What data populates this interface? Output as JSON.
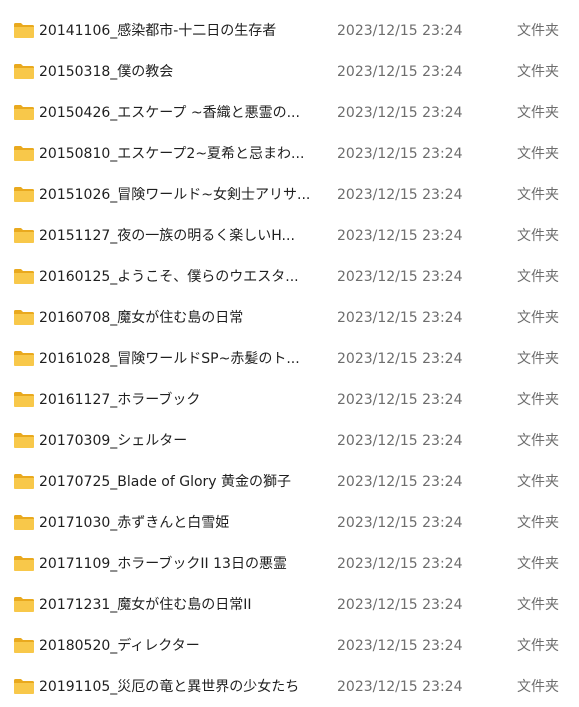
{
  "colors": {
    "folder_body": "#f8c84a",
    "folder_tab": "#e9a91e",
    "name_text": "#1f1f1f",
    "meta_text": "#6d6d6d",
    "background": "#ffffff"
  },
  "files": [
    {
      "name": "20141106_感染都市-十二日の生存者",
      "modified": "2023/12/15 23:24",
      "type": "文件夹",
      "icon": "folder-icon"
    },
    {
      "name": "20150318_僕の教会",
      "modified": "2023/12/15 23:24",
      "type": "文件夹",
      "icon": "folder-icon"
    },
    {
      "name": "20150426_エスケープ ~香織と悪霊の...",
      "modified": "2023/12/15 23:24",
      "type": "文件夹",
      "icon": "folder-icon"
    },
    {
      "name": "20150810_エスケープ2~夏希と忌まわ...",
      "modified": "2023/12/15 23:24",
      "type": "文件夹",
      "icon": "folder-icon"
    },
    {
      "name": "20151026_冒険ワールド~女剣士アリサ...",
      "modified": "2023/12/15 23:24",
      "type": "文件夹",
      "icon": "folder-icon"
    },
    {
      "name": "20151127_夜の一族の明るく楽しいH...",
      "modified": "2023/12/15 23:24",
      "type": "文件夹",
      "icon": "folder-icon"
    },
    {
      "name": "20160125_ようこそ、僕らのウエスタ...",
      "modified": "2023/12/15 23:24",
      "type": "文件夹",
      "icon": "folder-icon"
    },
    {
      "name": "20160708_魔女が住む島の日常",
      "modified": "2023/12/15 23:24",
      "type": "文件夹",
      "icon": "folder-icon"
    },
    {
      "name": "20161028_冒険ワールドSP~赤髪のト...",
      "modified": "2023/12/15 23:24",
      "type": "文件夹",
      "icon": "folder-icon"
    },
    {
      "name": "20161127_ホラーブック",
      "modified": "2023/12/15 23:24",
      "type": "文件夹",
      "icon": "folder-icon"
    },
    {
      "name": "20170309_シェルター",
      "modified": "2023/12/15 23:24",
      "type": "文件夹",
      "icon": "folder-icon"
    },
    {
      "name": "20170725_Blade of Glory 黄金の獅子",
      "modified": "2023/12/15 23:24",
      "type": "文件夹",
      "icon": "folder-icon"
    },
    {
      "name": "20171030_赤ずきんと白雪姫",
      "modified": "2023/12/15 23:24",
      "type": "文件夹",
      "icon": "folder-icon"
    },
    {
      "name": "20171109_ホラーブックII 13日の悪霊",
      "modified": "2023/12/15 23:24",
      "type": "文件夹",
      "icon": "folder-icon"
    },
    {
      "name": "20171231_魔女が住む島の日常II",
      "modified": "2023/12/15 23:24",
      "type": "文件夹",
      "icon": "folder-icon"
    },
    {
      "name": "20180520_ディレクター",
      "modified": "2023/12/15 23:24",
      "type": "文件夹",
      "icon": "folder-icon"
    },
    {
      "name": "20191105_災厄の竜と異世界の少女たち",
      "modified": "2023/12/15 23:24",
      "type": "文件夹",
      "icon": "folder-icon"
    }
  ]
}
